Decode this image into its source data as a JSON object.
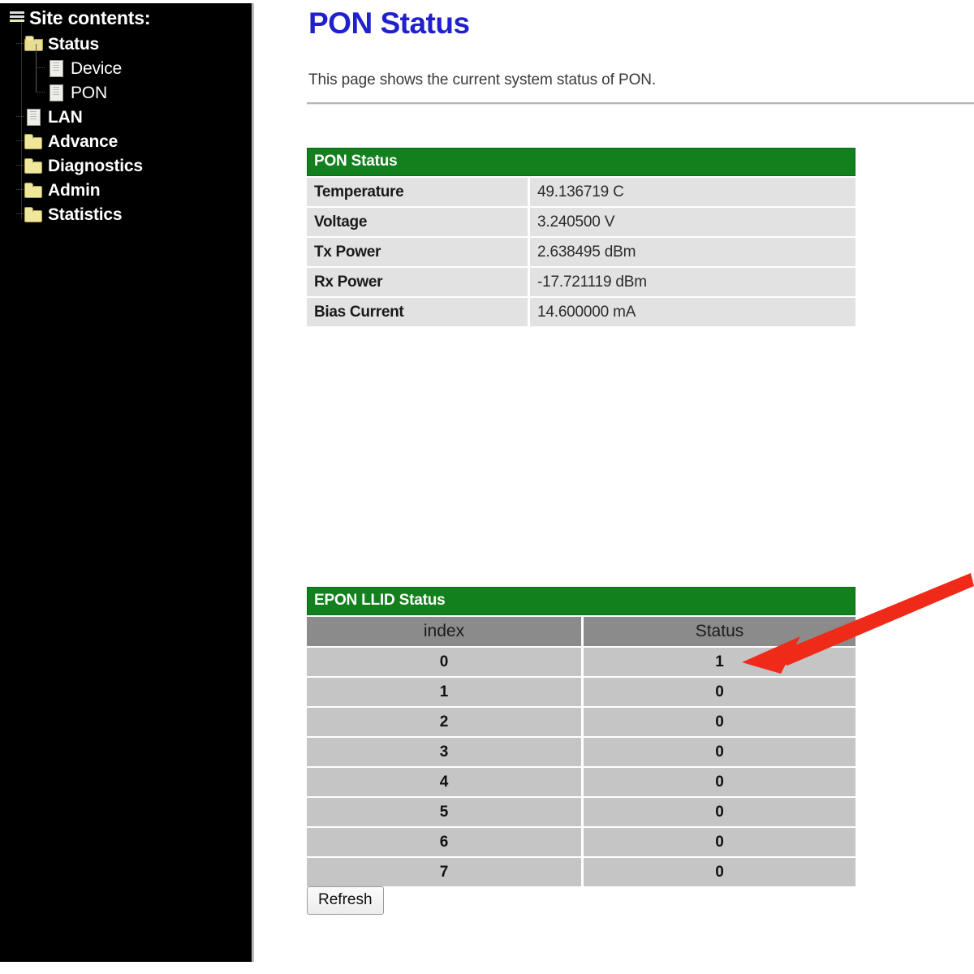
{
  "sidebar": {
    "title": "Site contents:",
    "title_icon": "menu-icon",
    "items": [
      {
        "label": "Status",
        "icon": "folder-open-icon",
        "level": 1
      },
      {
        "label": "Device",
        "icon": "page-icon",
        "level": 2
      },
      {
        "label": "PON",
        "icon": "page-icon",
        "level": 2
      },
      {
        "label": "LAN",
        "icon": "page-icon",
        "level": 1
      },
      {
        "label": "Advance",
        "icon": "folder-icon",
        "level": 1
      },
      {
        "label": "Diagnostics",
        "icon": "folder-icon",
        "level": 1
      },
      {
        "label": "Admin",
        "icon": "folder-icon",
        "level": 1
      },
      {
        "label": "Statistics",
        "icon": "folder-icon",
        "level": 1
      }
    ]
  },
  "main": {
    "title": "PON Status",
    "description": "This page shows the current system status of PON.",
    "pon_status": {
      "caption": "PON Status",
      "rows": [
        {
          "key": "Temperature",
          "value": "49.136719 C"
        },
        {
          "key": "Voltage",
          "value": "3.240500 V"
        },
        {
          "key": "Tx Power",
          "value": "2.638495 dBm"
        },
        {
          "key": "Rx Power",
          "value": "-17.721119 dBm"
        },
        {
          "key": "Bias Current",
          "value": "14.600000 mA"
        }
      ]
    },
    "llid_status": {
      "caption": "EPON LLID Status",
      "columns": [
        "index",
        "Status"
      ],
      "rows": [
        {
          "index": "0",
          "status": "1"
        },
        {
          "index": "1",
          "status": "0"
        },
        {
          "index": "2",
          "status": "0"
        },
        {
          "index": "3",
          "status": "0"
        },
        {
          "index": "4",
          "status": "0"
        },
        {
          "index": "5",
          "status": "0"
        },
        {
          "index": "6",
          "status": "0"
        },
        {
          "index": "7",
          "status": "0"
        }
      ]
    },
    "refresh_label": "Refresh"
  },
  "annotation": {
    "arrow_color": "#f02a18",
    "arrow_points_at": "llid-row-0-status"
  },
  "colors": {
    "title": "#2020cc",
    "table_caption_bg": "#12801c",
    "pon_row_bg": "#e2e2e2",
    "llid_header_bg": "#8b8b8b",
    "llid_row_bg": "#c5c5c5",
    "sidebar_bg": "#000000"
  }
}
